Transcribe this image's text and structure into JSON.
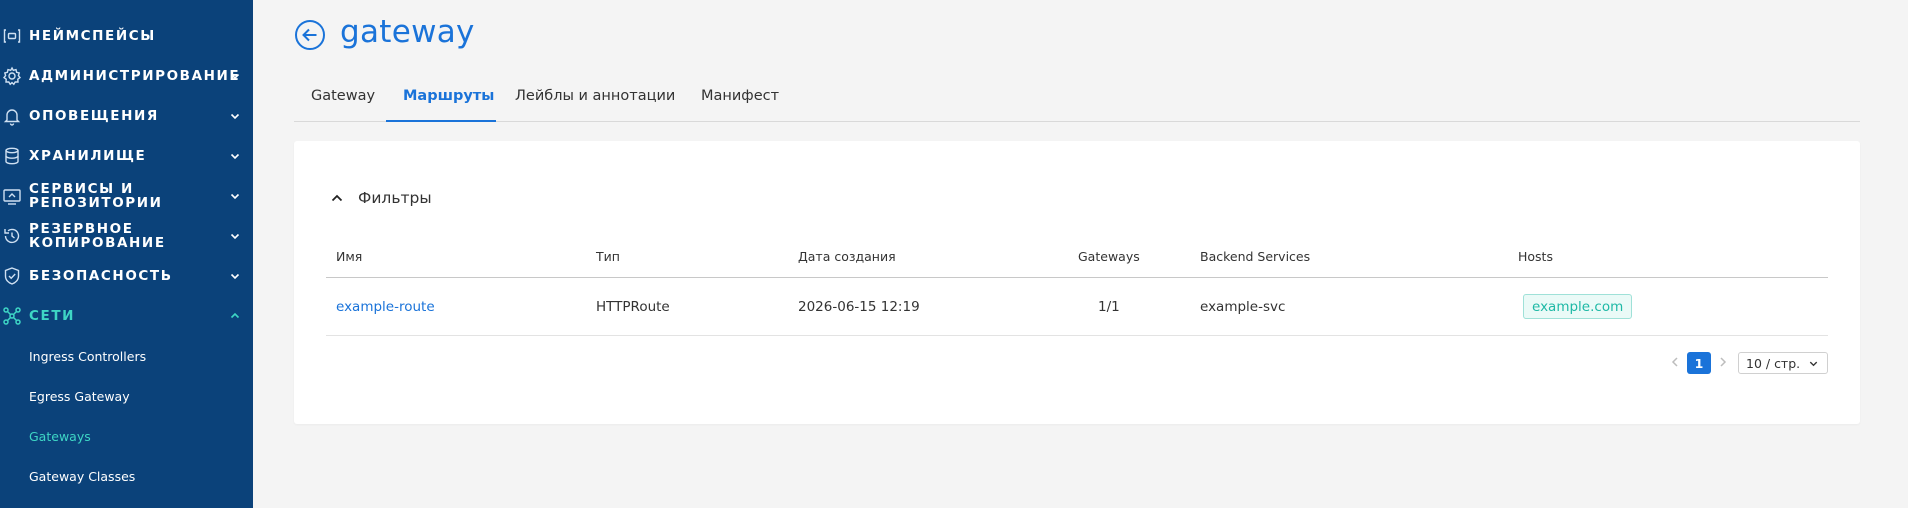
{
  "sidebar": {
    "items": [
      {
        "label": "НЕЙМСПЕЙСЫ",
        "icon": "namespace-icon",
        "has_chevron": false
      },
      {
        "label": "АДМИНИСТРИРОВАНИЕ",
        "icon": "gear-icon",
        "has_chevron": true
      },
      {
        "label": "ОПОВЕЩЕНИЯ",
        "icon": "bell-icon",
        "has_chevron": true
      },
      {
        "label": "ХРАНИЛИЩЕ",
        "icon": "database-icon",
        "has_chevron": true
      },
      {
        "label_line1": "СЕРВИСЫ И",
        "label_line2": "РЕПОЗИТОРИИ",
        "icon": "services-icon",
        "has_chevron": true
      },
      {
        "label_line1": "РЕЗЕРВНОЕ",
        "label_line2": "КОПИРОВАНИЕ",
        "icon": "backup-icon",
        "has_chevron": true
      },
      {
        "label": "БЕЗОПАСНОСТЬ",
        "icon": "shield-icon",
        "has_chevron": true
      },
      {
        "label": "СЕТИ",
        "icon": "network-icon",
        "has_chevron": true,
        "expanded": true
      }
    ],
    "subitems": [
      {
        "label": "Ingress Controllers",
        "active": false
      },
      {
        "label": "Egress Gateway",
        "active": false
      },
      {
        "label": "Gateways",
        "active": true
      },
      {
        "label": "Gateway Classes",
        "active": false
      }
    ],
    "colors": {
      "background": "#0b427a",
      "active": "#3ed6c5"
    }
  },
  "header": {
    "title": "gateway",
    "back_icon": "arrow-left-circle-icon"
  },
  "tabs": [
    {
      "label": "Gateway",
      "active": false
    },
    {
      "label": "Маршруты",
      "active": true
    },
    {
      "label": "Лейблы и аннотации",
      "active": false
    },
    {
      "label": "Манифест",
      "active": false
    }
  ],
  "filters": {
    "label": "Фильтры",
    "expanded": true
  },
  "table": {
    "columns": [
      "Имя",
      "Тип",
      "Дата создания",
      "Gateways",
      "Backend Services",
      "Hosts"
    ],
    "rows": [
      {
        "name": "example-route",
        "type": "HTTPRoute",
        "created": "2026-06-15 12:19",
        "gateways": "1/1",
        "backend": "example-svc",
        "host": "example.com"
      }
    ]
  },
  "pagination": {
    "current_page": "1",
    "page_size": "10 / стр."
  },
  "colors": {
    "accent": "#1a73d9",
    "teal": "#1fb9a6"
  }
}
